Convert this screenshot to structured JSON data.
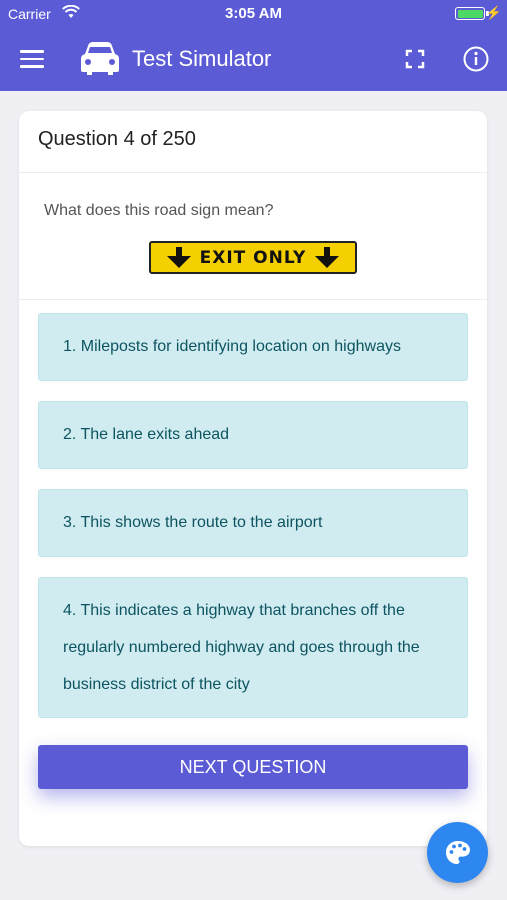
{
  "status_bar": {
    "carrier": "Carrier",
    "time": "3:05 AM"
  },
  "nav": {
    "title": "Test Simulator"
  },
  "card": {
    "header": "Question 4 of 250",
    "question": "What does this road sign mean?",
    "sign_text": "EXIT ONLY",
    "answers": [
      "1. Mileposts for identifying location on highways",
      "2. The lane exits ahead",
      "3. This shows the route to the airport",
      "4. This indicates a highway that branches off the regularly numbered highway and goes through the business district of the city"
    ],
    "next_button": "NEXT QUESTION"
  },
  "colors": {
    "primary": "#5b5bd6",
    "answer_bg": "#d1ecf1",
    "answer_text": "#0c5460",
    "sign_yellow": "#f5d000",
    "fab": "#2e86f0"
  },
  "icons": [
    "menu-icon",
    "car-icon",
    "fullscreen-icon",
    "info-icon",
    "palette-icon",
    "wifi-icon",
    "battery-icon"
  ]
}
